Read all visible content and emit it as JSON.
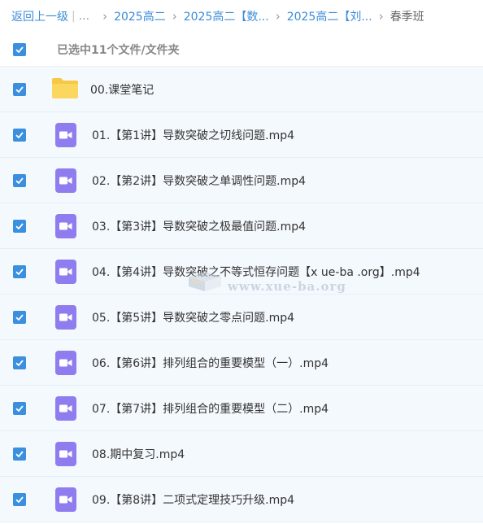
{
  "breadcrumb": {
    "back": "返回上一级",
    "ellipsis": "...",
    "items": [
      "2025高二",
      "2025高二【数...",
      "2025高二【刘..."
    ],
    "current": "春季班"
  },
  "selection": {
    "label": "已选中11个文件/文件夹",
    "checked": true
  },
  "files": [
    {
      "name": "00.课堂笔记",
      "type": "folder",
      "checked": true
    },
    {
      "name": "01.【第1讲】导数突破之切线问题.mp4",
      "type": "video",
      "checked": true
    },
    {
      "name": "02.【第2讲】导数突破之单调性问题.mp4",
      "type": "video",
      "checked": true
    },
    {
      "name": "03.【第3讲】导数突破之极最值问题.mp4",
      "type": "video",
      "checked": true
    },
    {
      "name": "04.【第4讲】导数突破之不等式恒存问题【x ue-ba .org】.mp4",
      "type": "video",
      "checked": true
    },
    {
      "name": "05.【第5讲】导数突破之零点问题.mp4",
      "type": "video",
      "checked": true
    },
    {
      "name": "06.【第6讲】排列组合的重要模型（一）.mp4",
      "type": "video",
      "checked": true
    },
    {
      "name": "07.【第7讲】排列组合的重要模型（二）.mp4",
      "type": "video",
      "checked": true
    },
    {
      "name": "08.期中复习.mp4",
      "type": "video",
      "checked": true
    },
    {
      "name": "09.【第8讲】二项式定理技巧升级.mp4",
      "type": "video",
      "checked": true
    }
  ],
  "watermark": "www.xue-ba.org",
  "colors": {
    "accent": "#3a8fde",
    "row_bg": "#f4f9fe",
    "video_icon": "#8f7df0",
    "folder_icon": "#f7c844"
  }
}
